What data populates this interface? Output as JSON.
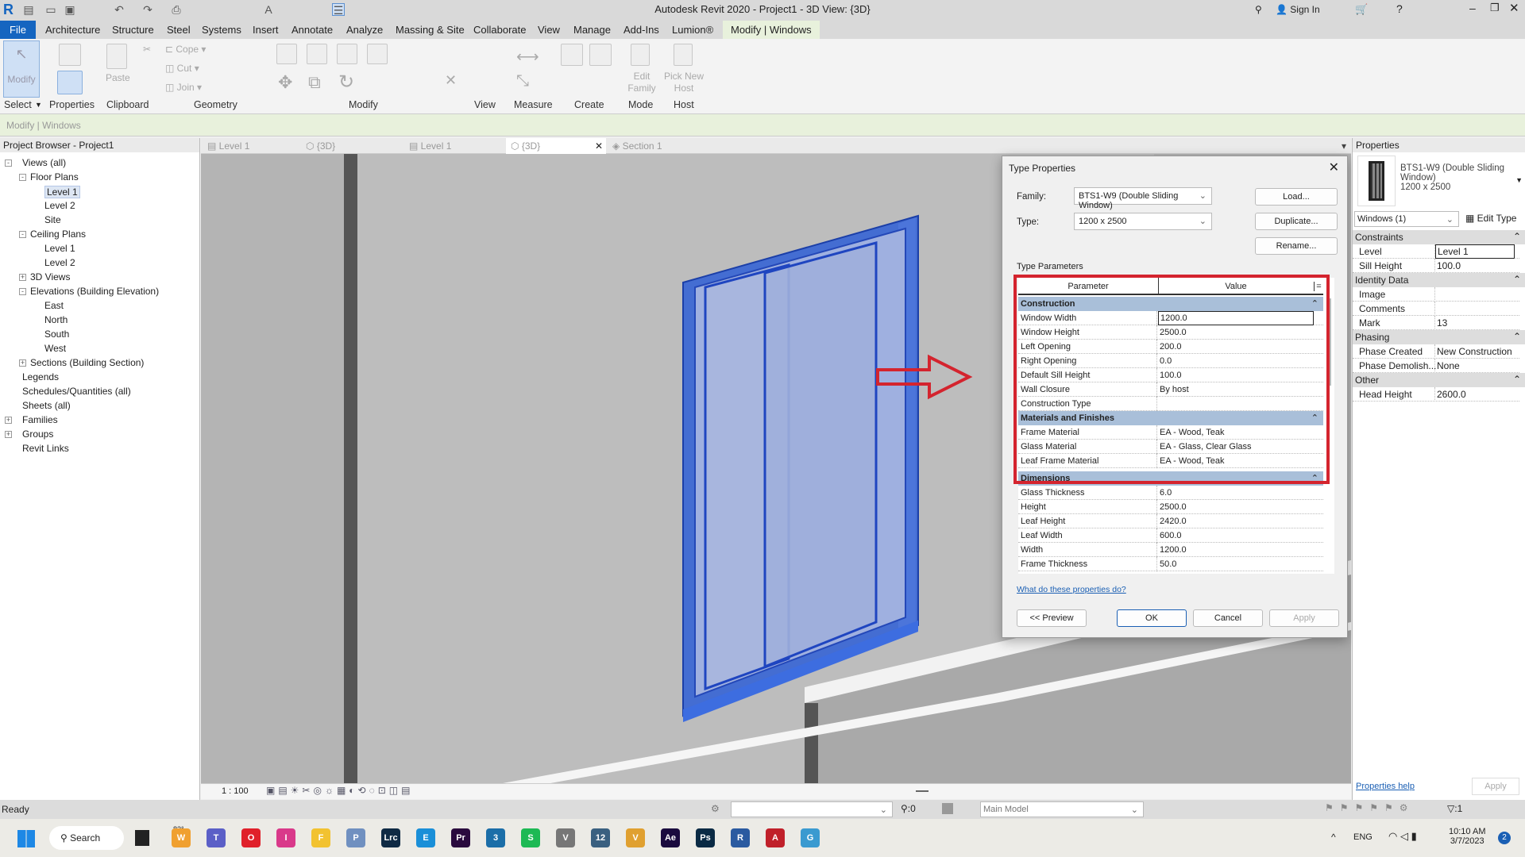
{
  "title": "Autodesk Revit 2020 - Project1 - 3D View: {3D}",
  "titlebar_right": {
    "sign_in": "Sign In"
  },
  "ribbon_tabs": [
    "File",
    "Architecture",
    "Structure",
    "Steel",
    "Systems",
    "Insert",
    "Annotate",
    "Analyze",
    "Massing & Site",
    "Collaborate",
    "View",
    "Manage",
    "Add-Ins",
    "Lumion®",
    "Modify | Windows"
  ],
  "ribbon_buttons": {
    "modify": "Modify",
    "paste": "Paste",
    "cope": "Cope",
    "cut": "Cut",
    "join": "Join",
    "edit_family": "Edit Family",
    "pick_new_host": "Pick New Host"
  },
  "ribbon_panels": [
    "Select",
    "Properties",
    "Clipboard",
    "Geometry",
    "Modify",
    "View",
    "Measure",
    "Create",
    "Mode",
    "Host"
  ],
  "options_bar": "Modify | Windows",
  "browser": {
    "title": "Project Browser - Project1",
    "items": [
      {
        "label": "Views (all)",
        "level": 0,
        "exp": "-"
      },
      {
        "label": "Floor Plans",
        "level": 1,
        "exp": "-"
      },
      {
        "label": "Level 1",
        "level": 2,
        "selected": true
      },
      {
        "label": "Level 2",
        "level": 2
      },
      {
        "label": "Site",
        "level": 2
      },
      {
        "label": "Ceiling Plans",
        "level": 1,
        "exp": "-"
      },
      {
        "label": "Level 1",
        "level": 2
      },
      {
        "label": "Level 2",
        "level": 2
      },
      {
        "label": "3D Views",
        "level": 1,
        "exp": "+"
      },
      {
        "label": "Elevations (Building Elevation)",
        "level": 1,
        "exp": "-"
      },
      {
        "label": "East",
        "level": 2
      },
      {
        "label": "North",
        "level": 2
      },
      {
        "label": "South",
        "level": 2
      },
      {
        "label": "West",
        "level": 2
      },
      {
        "label": "Sections (Building Section)",
        "level": 1,
        "exp": "+"
      },
      {
        "label": "Legends",
        "level": 0
      },
      {
        "label": "Schedules/Quantities (all)",
        "level": 0
      },
      {
        "label": "Sheets (all)",
        "level": 0
      },
      {
        "label": "Families",
        "level": 0,
        "exp": "+"
      },
      {
        "label": "Groups",
        "level": 0,
        "exp": "+"
      },
      {
        "label": "Revit Links",
        "level": 0
      }
    ]
  },
  "view_tabs": [
    "Level 1",
    "{3D}",
    "Level 1",
    "{3D}",
    "Section 1"
  ],
  "view_scale": "1 : 100",
  "dialog": {
    "title": "Type Properties",
    "family_label": "Family:",
    "family_value": "BTS1-W9 (Double Sliding Window)",
    "type_label": "Type:",
    "type_value": "1200 x 2500",
    "load": "Load...",
    "duplicate": "Duplicate...",
    "rename": "Rename...",
    "type_parameters": "Type Parameters",
    "col_parameter": "Parameter",
    "col_value": "Value",
    "col_eq": "=",
    "groups": [
      {
        "name": "Construction",
        "rows": [
          [
            "Window Width",
            "1200.0"
          ],
          [
            "Window Height",
            "2500.0"
          ],
          [
            "Left Opening",
            "200.0"
          ],
          [
            "Right Opening",
            "0.0"
          ],
          [
            "Default Sill Height",
            "100.0"
          ],
          [
            "Wall Closure",
            "By host"
          ],
          [
            "Construction Type",
            ""
          ]
        ]
      },
      {
        "name": "Materials and Finishes",
        "rows": [
          [
            "Frame Material",
            "EA - Wood, Teak"
          ],
          [
            "Glass Material",
            "EA - Glass, Clear Glass"
          ],
          [
            "Leaf Frame Material",
            "EA - Wood, Teak"
          ]
        ]
      },
      {
        "name": "Dimensions",
        "rows": [
          [
            "Glass Thickness",
            "6.0"
          ],
          [
            "Height",
            "2500.0"
          ],
          [
            "Leaf Height",
            "2420.0"
          ],
          [
            "Leaf Width",
            "600.0"
          ],
          [
            "Width",
            "1200.0"
          ],
          [
            "Frame Thickness",
            "50.0"
          ]
        ]
      }
    ],
    "help_link": "What do these properties do?",
    "preview": "<< Preview",
    "ok": "OK",
    "cancel": "Cancel",
    "apply": "Apply"
  },
  "properties": {
    "title": "Properties",
    "type_name": "BTS1-W9 (Double Sliding Window)",
    "type_size": "1200 x 2500",
    "selector": "Windows (1)",
    "edit_type": "Edit Type",
    "groups": [
      {
        "name": "Constraints",
        "rows": [
          [
            "Level",
            "Level 1"
          ],
          [
            "Sill Height",
            "100.0"
          ]
        ]
      },
      {
        "name": "Identity Data",
        "rows": [
          [
            "Image",
            ""
          ],
          [
            "Comments",
            ""
          ],
          [
            "Mark",
            "13"
          ]
        ]
      },
      {
        "name": "Phasing",
        "rows": [
          [
            "Phase Created",
            "New Construction"
          ],
          [
            "Phase Demolish...",
            "None"
          ]
        ]
      },
      {
        "name": "Other",
        "rows": [
          [
            "Head Height",
            "2600.0"
          ]
        ]
      }
    ],
    "help": "Properties help",
    "apply": "Apply"
  },
  "status": {
    "text": "Ready",
    "workset": ":0",
    "model": "Main Model",
    "filter": ":1"
  },
  "taskbar": {
    "search": "Search",
    "weather": "83°",
    "lang": "ENG",
    "time": "10:10 AM",
    "date": "3/7/2023",
    "badge": "2",
    "apps": [
      [
        "#f0a030",
        "W"
      ],
      [
        "#5b5fc7",
        "T"
      ],
      [
        "#e0202a",
        "O"
      ],
      [
        "#d9398a",
        "I"
      ],
      [
        "#f2c230",
        "F"
      ],
      [
        "#7090c0",
        "P"
      ],
      [
        "#0f2a44",
        "Lrc"
      ],
      [
        "#1a8fd8",
        "E"
      ],
      [
        "#2a0a3e",
        "Pr"
      ],
      [
        "#1b6ea8",
        "3"
      ],
      [
        "#1db954",
        "S"
      ],
      [
        "#777",
        "V"
      ],
      [
        "#3a6080",
        "12"
      ],
      [
        "#e0a030",
        "V"
      ],
      [
        "#1a0a3e",
        "Ae"
      ],
      [
        "#0a2a44",
        "Ps"
      ],
      [
        "#2a5aa0",
        "R"
      ],
      [
        "#c0202a",
        "A"
      ],
      [
        "#3a9ad0",
        "G"
      ]
    ]
  },
  "colors": {
    "accent": "#1565c0",
    "highlight": "#d4242e",
    "group": "#a9bfd9"
  }
}
